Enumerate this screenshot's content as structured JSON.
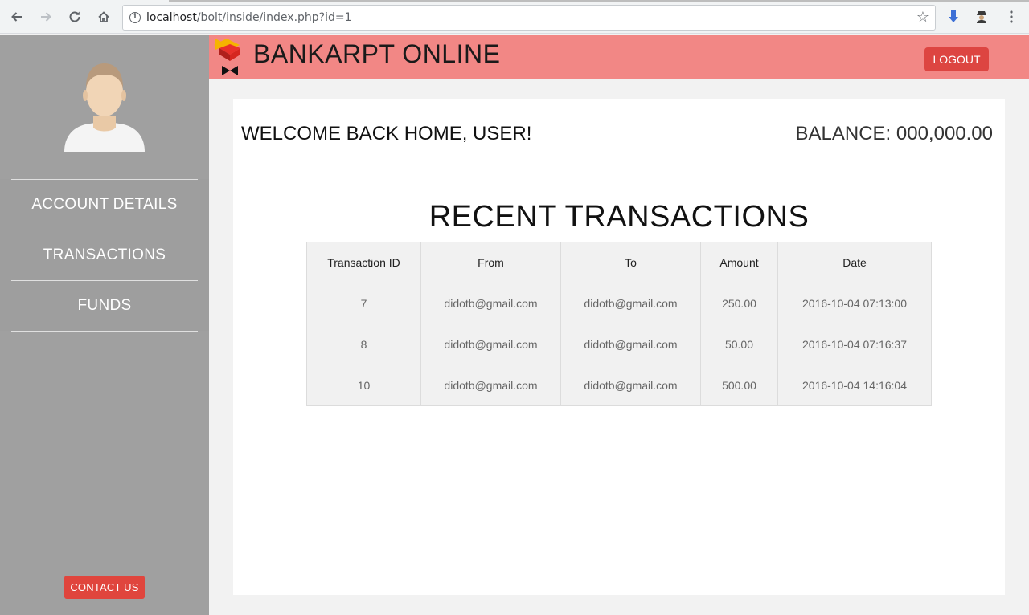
{
  "browser": {
    "url_host": "localhost",
    "url_path": "/bolt/inside/index.php?id=1"
  },
  "header": {
    "brand": "BANKARPT ONLINE",
    "logout_label": "LOGOUT",
    "color": "#f28785"
  },
  "sidebar": {
    "items": [
      {
        "label": "ACCOUNT DETAILS"
      },
      {
        "label": "TRANSACTIONS"
      },
      {
        "label": "FUNDS"
      }
    ],
    "contact_label": "CONTACT US"
  },
  "main": {
    "welcome": "WELCOME BACK HOME, USER!",
    "balance": "BALANCE: 000,000.00",
    "section_title": "RECENT TRANSACTIONS",
    "table": {
      "headers": [
        "Transaction ID",
        "From",
        "To",
        "Amount",
        "Date"
      ],
      "rows": [
        [
          "7",
          "didotb@gmail.com",
          "didotb@gmail.com",
          "250.00",
          "2016-10-04 07:13:00"
        ],
        [
          "8",
          "didotb@gmail.com",
          "didotb@gmail.com",
          "50.00",
          "2016-10-04 07:16:37"
        ],
        [
          "10",
          "didotb@gmail.com",
          "didotb@gmail.com",
          "500.00",
          "2016-10-04 14:16:04"
        ]
      ]
    }
  }
}
